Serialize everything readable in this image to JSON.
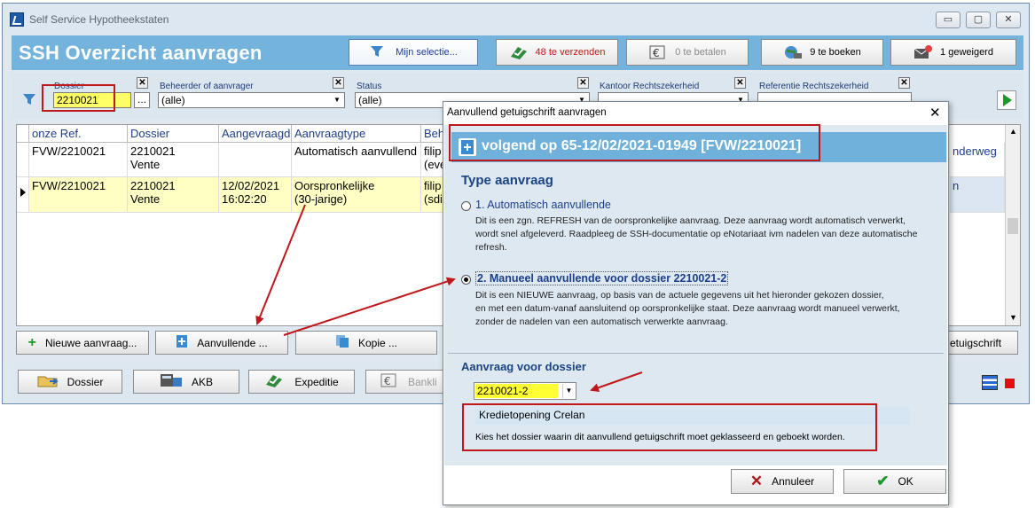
{
  "window": {
    "title": "Self Service Hypotheekstaten",
    "controls": [
      "▭",
      "▢",
      "✕"
    ]
  },
  "header": {
    "title": "SSH  Overzicht aanvragen",
    "buttons": {
      "mijn_selectie": "Mijn selectie...",
      "te_verzenden": "48 te verzenden",
      "te_betalen": "0 te betalen",
      "te_boeken": "9 te boeken",
      "geweigerd": "1 geweigerd"
    }
  },
  "filters": {
    "dossier": {
      "label": "Dossier",
      "value": "2210021",
      "browse": "..."
    },
    "beheerder": {
      "label": "Beheerder of aanvrager",
      "value": "(alle)"
    },
    "status": {
      "label": "Status",
      "value": "(alle)"
    },
    "kantoor": {
      "label": "Kantoor Rechtszekerheid"
    },
    "referentie": {
      "label": "Referentie Rechtszekerheid"
    },
    "clear": "✕"
  },
  "grid": {
    "columns": [
      "onze Ref.",
      "Dossier",
      "Aangevraagd",
      "Aanvraagtype",
      "Beh"
    ],
    "rows": [
      {
        "ref": "FVW/2210021",
        "dossier": "2210021",
        "dossier2": "Vente",
        "aangevraagd": "",
        "aangevraagd2": "",
        "type": "Automatisch aanvullend",
        "type2": "",
        "beh": "filip",
        "beh2": "(eve",
        "right": "nderweg"
      },
      {
        "ref": "FVW/2210021",
        "dossier": "2210021",
        "dossier2": "Vente",
        "aangevraagd": "12/02/2021",
        "aangevraagd2": "16:02:20",
        "type": "Oorspronkelijke",
        "type2": "(30-jarige)",
        "beh": "filip",
        "beh2": "(sdi",
        "right": "n"
      }
    ]
  },
  "actions": {
    "nieuwe": "Nieuwe aanvraag...",
    "aanvullende": "Aanvullende ...",
    "kopie": "Kopie ...",
    "getuigschrift": "etuigschrift"
  },
  "bottom": {
    "dossier": "Dossier",
    "akb": "AKB",
    "expeditie": "Expeditie",
    "bankli": "Bankli"
  },
  "dialog": {
    "title": "Aanvullend getuigschrift aanvragen",
    "close": "✕",
    "header": "volgend op 65-12/02/2021-01949  [FVW/2210021]",
    "type_heading": "Type aanvraag",
    "option1": {
      "label": "1. Automatisch aanvullende",
      "desc": [
        "Dit is een zgn. REFRESH van de oorspronkelijke aanvraag. Deze aanvraag wordt automatisch verwerkt,",
        "wordt snel afgeleverd. Raadpleeg de SSH-documentatie op eNotariaat ivm nadelen van deze automatische",
        "refresh."
      ]
    },
    "option2": {
      "label": "2. Manueel aanvullende voor dossier 2210021-2",
      "desc": [
        "Dit is een NIEUWE aanvraag, op basis van de actuele gegevens uit het hieronder gekozen dossier,",
        "en met een datum-vanaf aansluitend op oorspronkelijke staat. Deze aanvraag wordt manueel verwerkt,",
        "zonder de nadelen van een automatisch verwerkte aanvraag."
      ]
    },
    "dossier_heading": "Aanvraag voor dossier",
    "dossier_value": "2210021-2",
    "dossier_name": "Kredietopening Crelan",
    "dossier_hint": "Kies het dossier waarin dit aanvullend getuigschrift moet geklasseerd en geboekt worden.",
    "cancel": "Annuleer",
    "ok": "OK"
  },
  "colors": {
    "accent": "#73b3dc",
    "highlight_row": "#ffffc4",
    "annotation_red": "#c0171c",
    "field_yellow": "#ffff66"
  }
}
